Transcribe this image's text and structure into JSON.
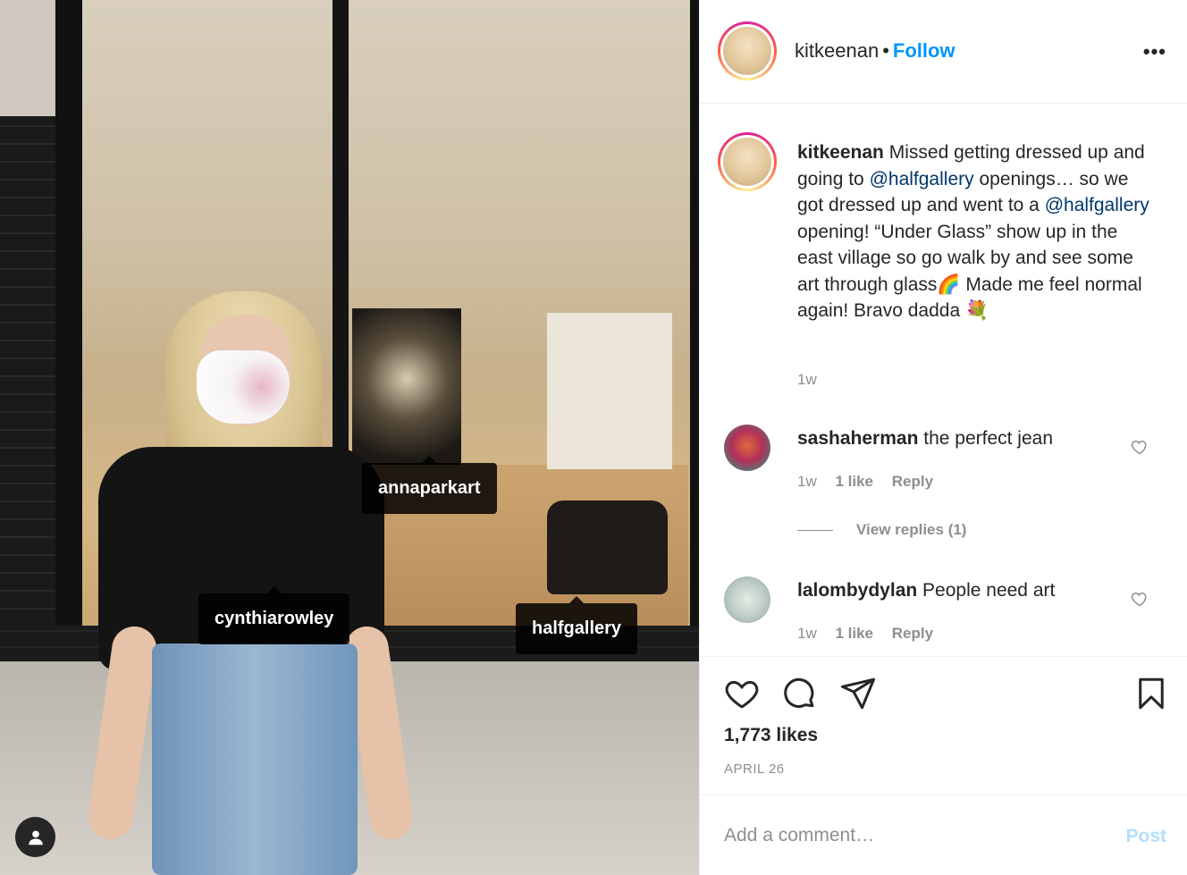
{
  "photo": {
    "tags": [
      {
        "label": "annaparkart"
      },
      {
        "label": "cynthiarowley"
      },
      {
        "label": "halfgallery"
      }
    ],
    "user_tags_icon": "person-icon"
  },
  "header": {
    "username": "kitkeenan",
    "separator": "•",
    "follow_label": "Follow",
    "more_icon": "more-horizontal-icon",
    "more_label": "•••"
  },
  "caption": {
    "username": "kitkeenan",
    "text_1": " Missed getting dressed up and going to ",
    "mention_1": "@halfgallery",
    "text_2": " openings… so we got dressed up and went to a ",
    "mention_2": "@halfgallery",
    "text_3": " opening! “Under Glass” show up in the east village so go walk by and see some art through glass🌈 Made me feel normal again! Bravo dadda 💐",
    "time": "1w"
  },
  "comments": [
    {
      "username": "sashaherman",
      "text": " the perfect jean",
      "time": "1w",
      "likes": "1 like",
      "reply": "Reply"
    },
    {
      "username": "lalombydylan",
      "text": " People need art",
      "time": "1w",
      "likes": "1 like",
      "reply": "Reply"
    }
  ],
  "view_replies": "View replies (1)",
  "actions": {
    "like_icon": "heart-icon",
    "comment_icon": "comment-icon",
    "share_icon": "send-icon",
    "save_icon": "bookmark-icon"
  },
  "likes": "1,773 likes",
  "date": "APRIL 26",
  "add_comment": {
    "placeholder": "Add a comment…",
    "post_label": "Post"
  },
  "colors": {
    "accent": "#0095f6",
    "mention": "#00376b",
    "muted": "#8e8e8e",
    "post_disabled": "#b2dffc"
  }
}
